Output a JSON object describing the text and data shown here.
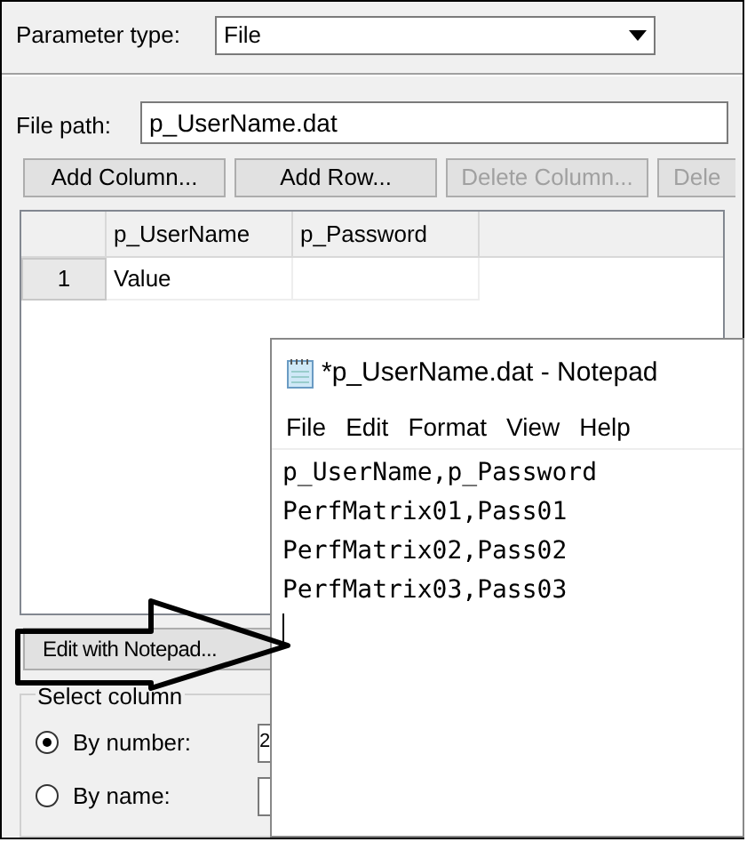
{
  "parameter_type": {
    "label": "Parameter type:",
    "value": "File"
  },
  "file_path": {
    "label": "File path:",
    "value": "p_UserName.dat"
  },
  "buttons": [
    {
      "label": "Add Column...",
      "disabled": false
    },
    {
      "label": "Add Row...",
      "disabled": false
    },
    {
      "label": "Delete Column...",
      "disabled": true
    },
    {
      "label": "Dele",
      "disabled": true
    }
  ],
  "table": {
    "columns": [
      "p_UserName",
      "p_Password"
    ],
    "rows": [
      {
        "number": "1",
        "cells": [
          "Value",
          ""
        ]
      }
    ]
  },
  "edit_button": "Edit with Notepad...",
  "select_column": {
    "title": "Select column",
    "options": [
      {
        "label": "By number:",
        "selected": true,
        "value": "2"
      },
      {
        "label": "By name:",
        "selected": false
      }
    ]
  },
  "notepad": {
    "title": "*p_UserName.dat - Notepad",
    "menu": [
      "File",
      "Edit",
      "Format",
      "View",
      "Help"
    ],
    "lines": [
      "p_UserName,p_Password",
      "PerfMatrix01,Pass01",
      "PerfMatrix02,Pass02",
      "PerfMatrix03,Pass03"
    ]
  }
}
